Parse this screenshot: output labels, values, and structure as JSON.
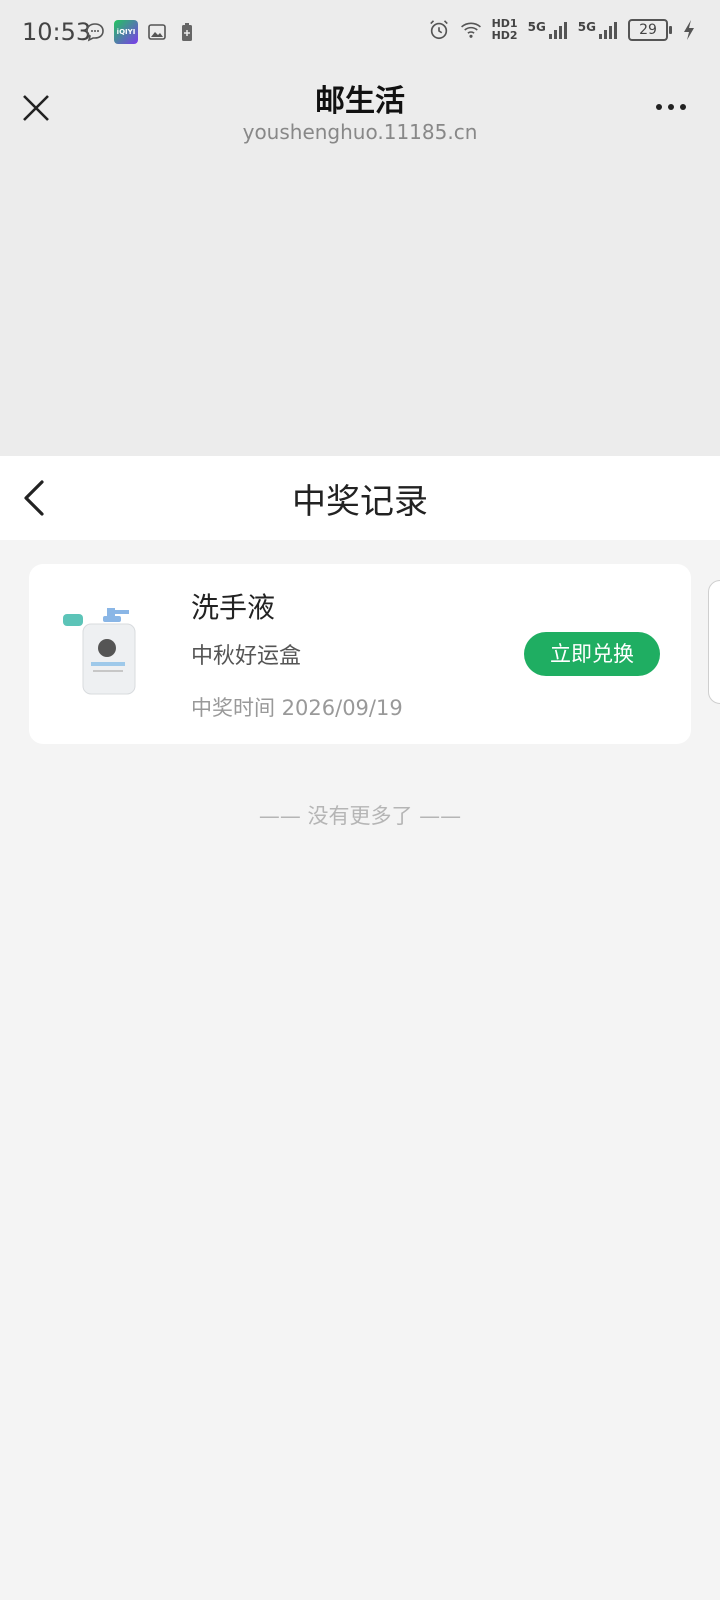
{
  "status_bar": {
    "time": "10:53",
    "left_icons": [
      "chat-bubble-icon",
      "iqiyi-app-icon",
      "image-icon",
      "battery-saver-icon"
    ],
    "app_badge_text": "iQIYI",
    "right_icons": [
      "alarm-icon",
      "wifi-icon",
      "hd-icon",
      "signal-5g-icon",
      "signal-5g-icon-2",
      "battery-icon",
      "charging-icon"
    ],
    "hd1": "HD1",
    "hd2": "HD2",
    "net1": "5G",
    "net2": "5G",
    "battery_level": "29"
  },
  "browser_bar": {
    "title": "邮生活",
    "url": "youshenghuo.11185.cn"
  },
  "nav": {
    "title": "中奖记录"
  },
  "records": [
    {
      "name": "洗手液",
      "box": "中秋好运盒",
      "time_label": "中奖时间 2026/09/19",
      "action_label": "立即兑换"
    }
  ],
  "footer": {
    "no_more": "—— 没有更多了 ——"
  },
  "colors": {
    "accent": "#1fae62",
    "header_bg": "#ececec",
    "page_bg": "#f4f4f4"
  }
}
